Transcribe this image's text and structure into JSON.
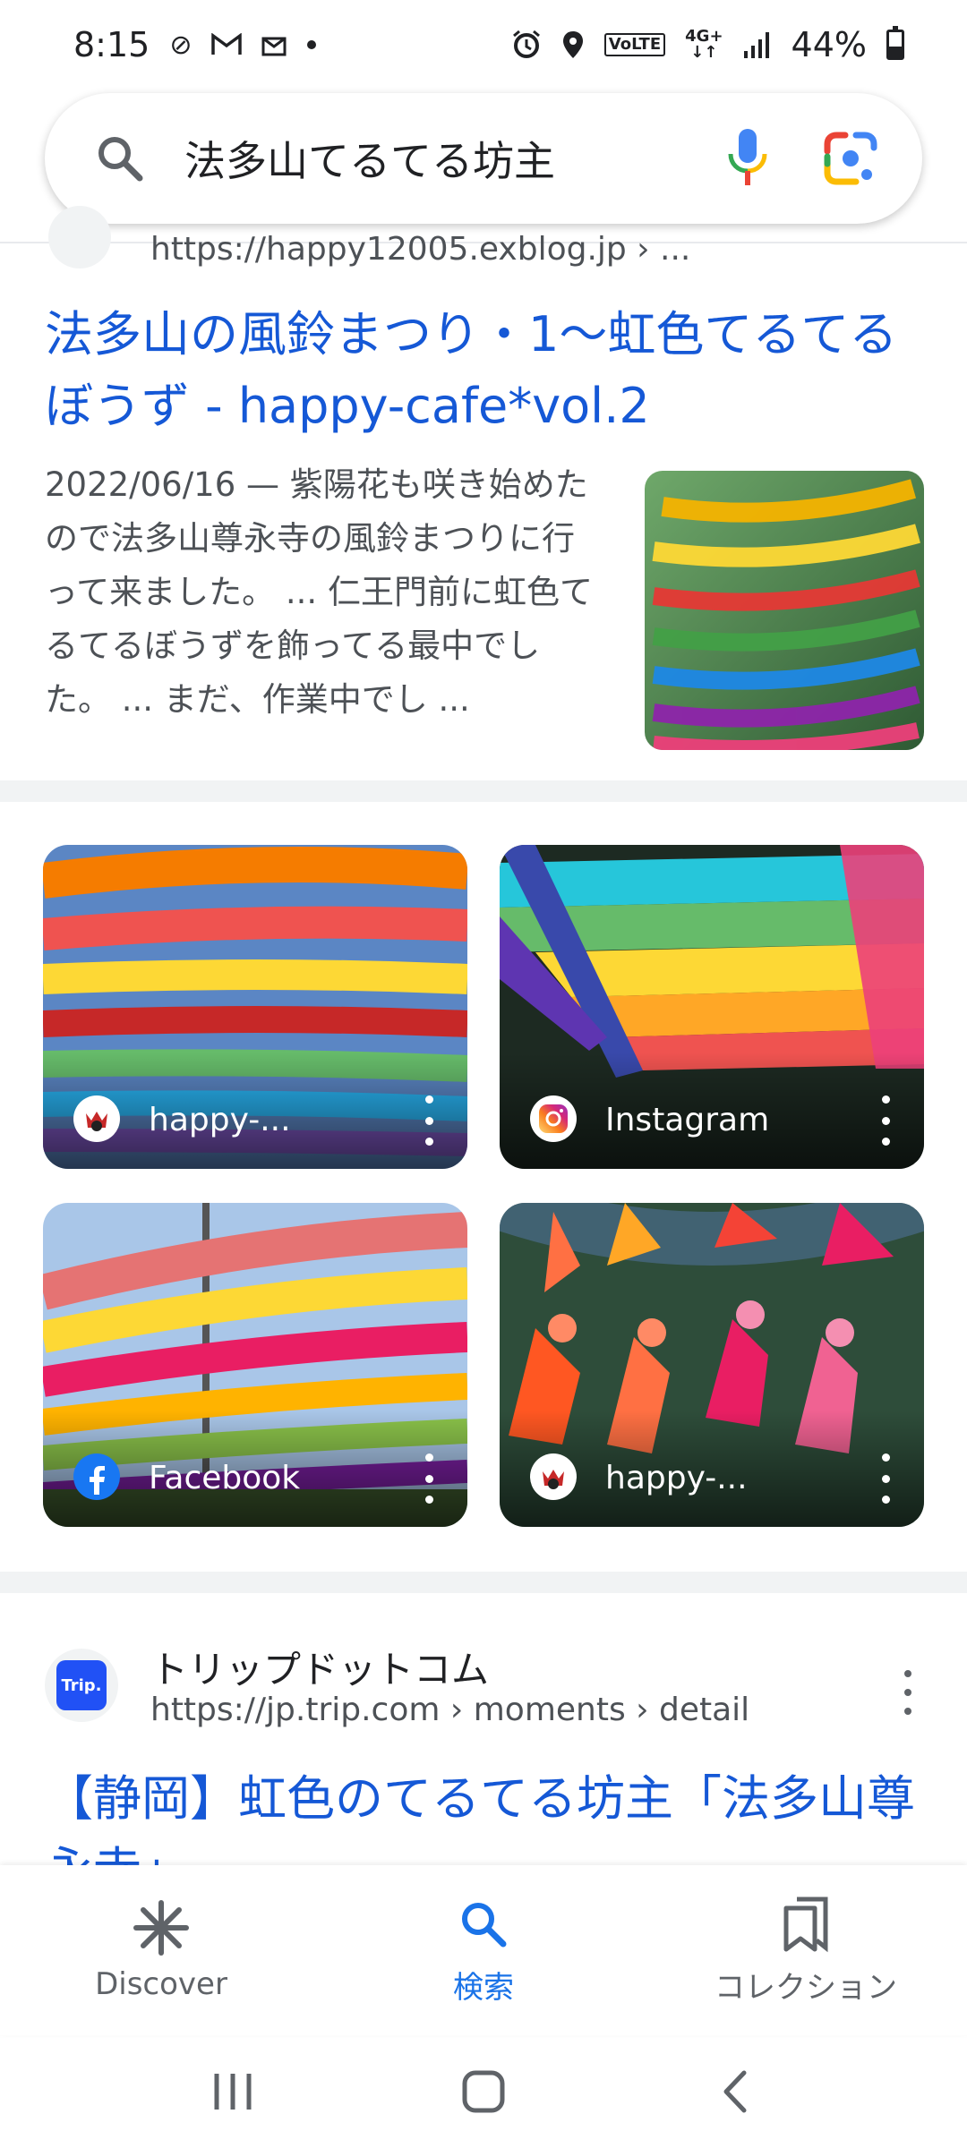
{
  "status_bar": {
    "time": "8:15",
    "net_top": "4G+",
    "net_bottom": "↓↑",
    "volte": "VoLTE",
    "battery": "44%"
  },
  "search": {
    "query": "法多山てるてる坊主"
  },
  "result1": {
    "url_partial": "https://happy12005.exblog.jp › ...",
    "title": "法多山の風鈴まつり・1～虹色てるてるぼうず - happy-cafe*vol.2",
    "snippet": "2022/06/16 — 紫陽花も咲き始めたので法多山尊永寺の風鈴まつりに行って来ました。 ... 仁王門前に虹色てるてるぼうずを飾ってる最中でした。 ... まだ、作業中でし ..."
  },
  "images": [
    {
      "source": "happy-..."
    },
    {
      "source": "Instagram"
    },
    {
      "source": "Facebook"
    },
    {
      "source": "happy-..."
    }
  ],
  "result2": {
    "favicon_text": "Trip.",
    "site": "トリップドットコム",
    "url": "https://jp.trip.com › moments › detail",
    "title": "【静岡】虹色のてるてる坊主「法多山尊永寺」"
  },
  "bottom_nav": {
    "discover": "Discover",
    "search": "検索",
    "collections": "コレクション"
  },
  "colors": {
    "link": "#1558d6",
    "accent": "#1a73e8"
  }
}
